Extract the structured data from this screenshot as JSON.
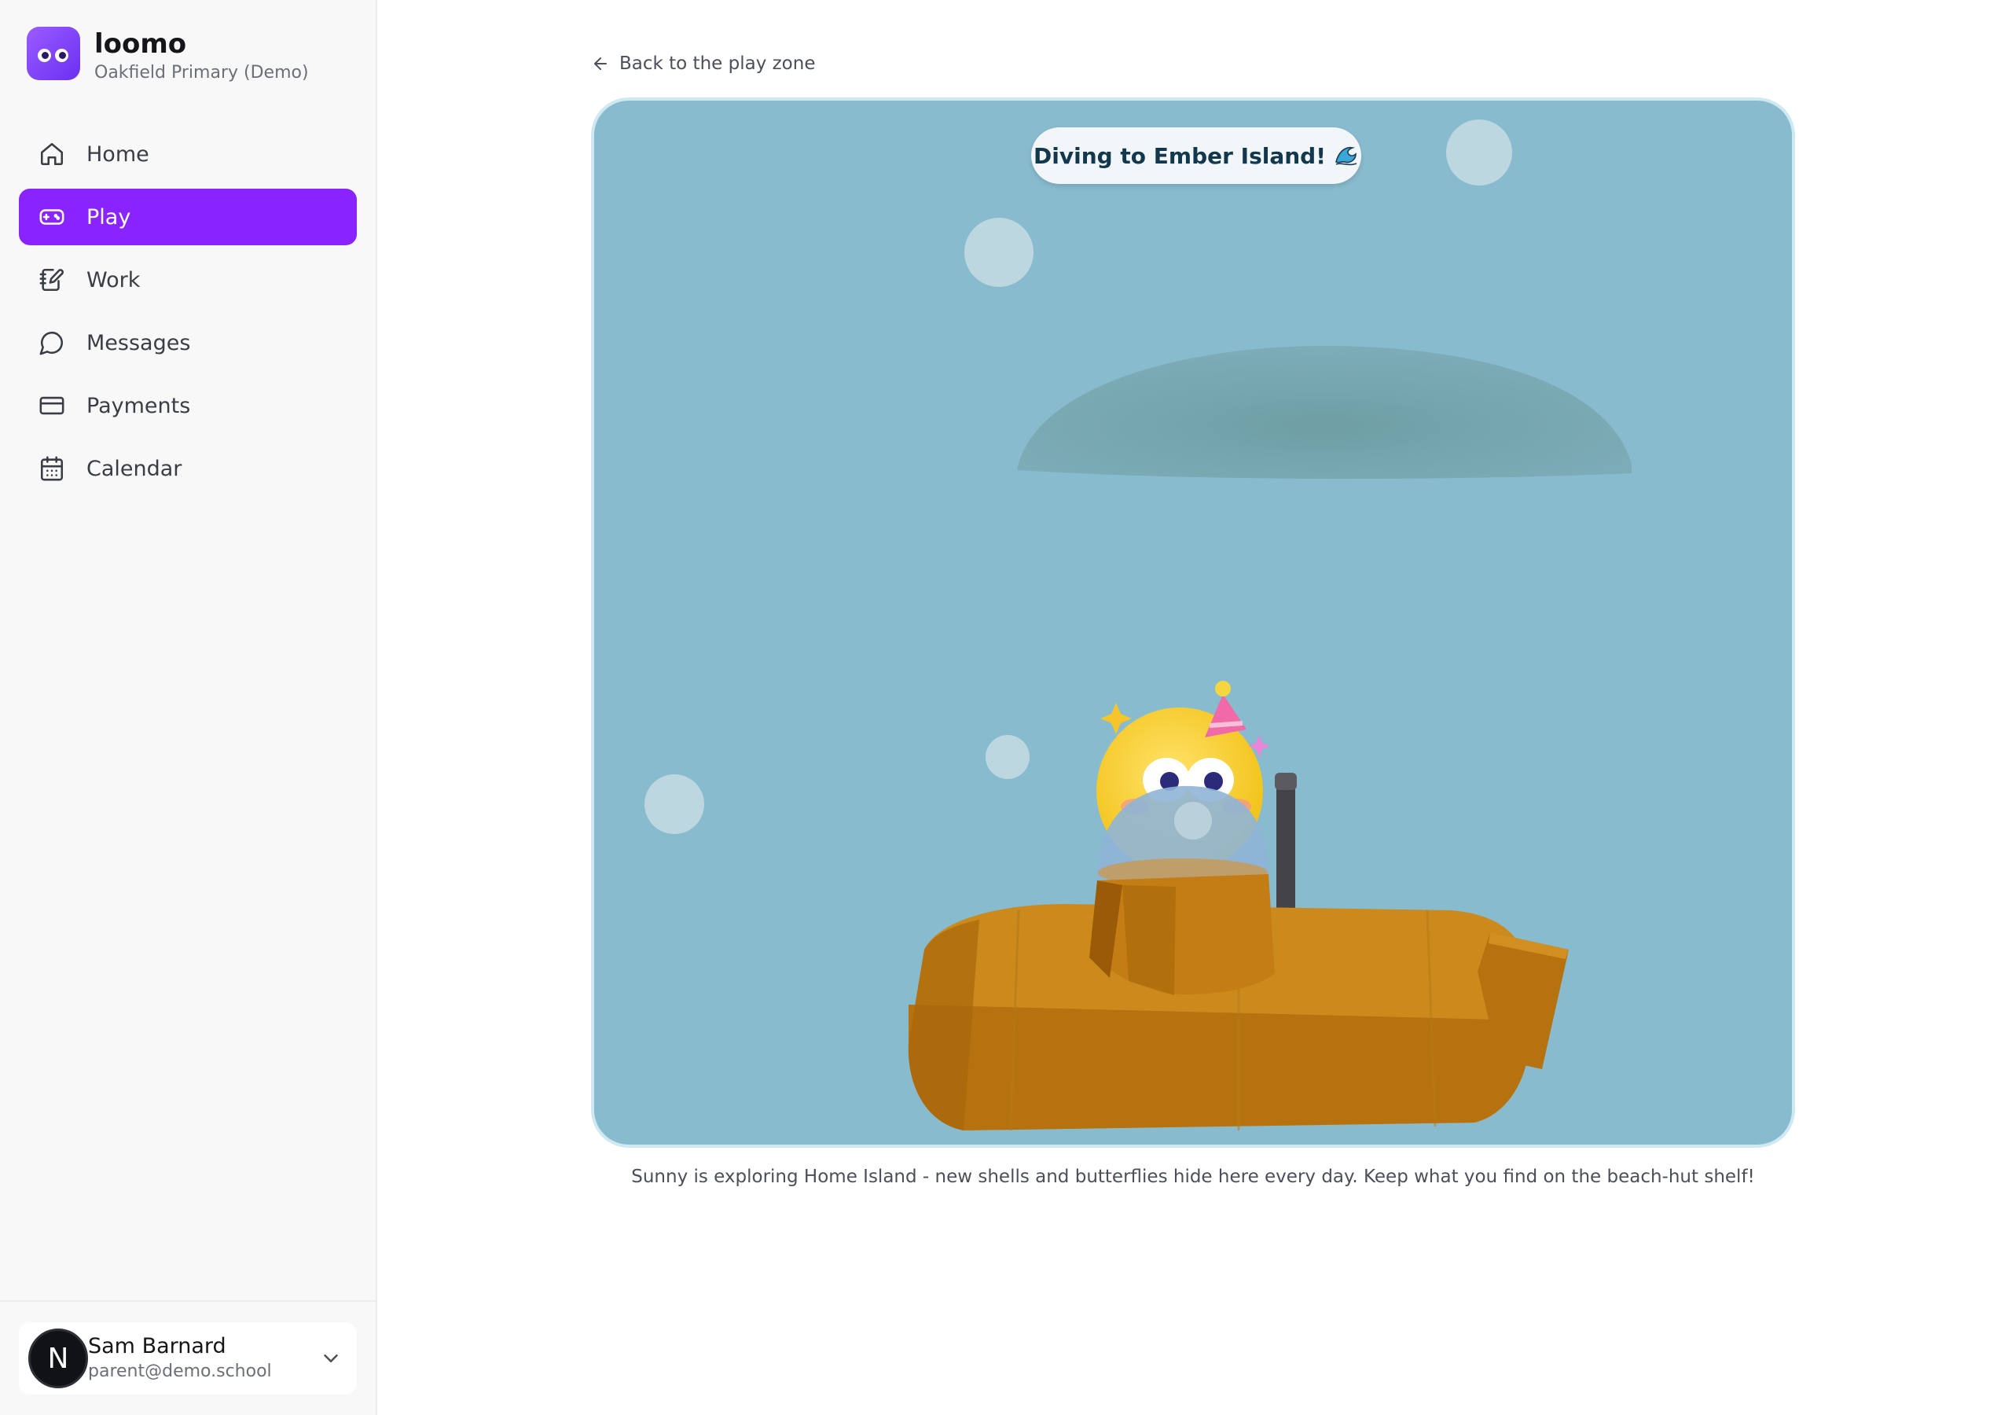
{
  "app": {
    "name": "loomo",
    "school": "Oakfield Primary (Demo)"
  },
  "nav": {
    "items": [
      {
        "label": "Home",
        "icon": "home-icon"
      },
      {
        "label": "Play",
        "icon": "gamepad-icon",
        "active": true
      },
      {
        "label": "Work",
        "icon": "notebook-pen-icon"
      },
      {
        "label": "Messages",
        "icon": "message-circle-icon"
      },
      {
        "label": "Payments",
        "icon": "credit-card-icon"
      },
      {
        "label": "Calendar",
        "icon": "calendar-icon"
      }
    ]
  },
  "user": {
    "initial": "N",
    "name": "Sam Barnard",
    "email": "parent@demo.school"
  },
  "main": {
    "back_label": "Back to the play zone",
    "banner": "Diving to Ember Island!",
    "banner_icon": "wave-icon",
    "caption": "Sunny is exploring Home Island - new shells and butterflies hide here every day. Keep what you find on the beach-hut shelf!"
  },
  "colors": {
    "accent": "#8a24ff",
    "water": "#88bbce",
    "submarine": "#c98419",
    "sunny": "#f5cf2a"
  }
}
